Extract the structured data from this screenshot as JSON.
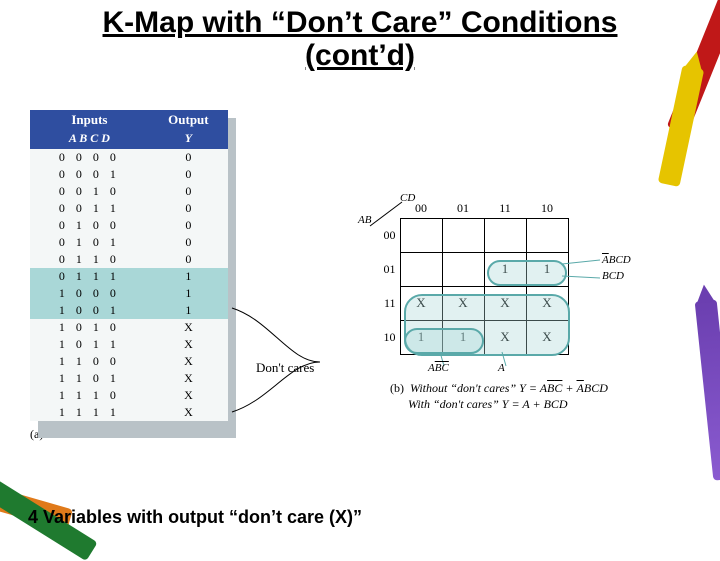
{
  "title_line1": "K-Map with “Don’t Care” Conditions",
  "title_line2": "(cont’d)",
  "truth_table": {
    "head_inputs": "Inputs",
    "head_output": "Output",
    "sub_inputs": "A B C D",
    "sub_output": "Y",
    "rows": [
      {
        "in": "0 0 0 0",
        "out": "0",
        "hi": false
      },
      {
        "in": "0 0 0 1",
        "out": "0",
        "hi": false
      },
      {
        "in": "0 0 1 0",
        "out": "0",
        "hi": false
      },
      {
        "in": "0 0 1 1",
        "out": "0",
        "hi": false
      },
      {
        "in": "0 1 0 0",
        "out": "0",
        "hi": false
      },
      {
        "in": "0 1 0 1",
        "out": "0",
        "hi": false
      },
      {
        "in": "0 1 1 0",
        "out": "0",
        "hi": false
      },
      {
        "in": "0 1 1 1",
        "out": "1",
        "hi": true
      },
      {
        "in": "1 0 0 0",
        "out": "1",
        "hi": true
      },
      {
        "in": "1 0 0 1",
        "out": "1",
        "hi": true
      },
      {
        "in": "1 0 1 0",
        "out": "X",
        "hi": false
      },
      {
        "in": "1 0 1 1",
        "out": "X",
        "hi": false
      },
      {
        "in": "1 1 0 0",
        "out": "X",
        "hi": false
      },
      {
        "in": "1 1 0 1",
        "out": "X",
        "hi": false
      },
      {
        "in": "1 1 1 0",
        "out": "X",
        "hi": false
      },
      {
        "in": "1 1 1 1",
        "out": "X",
        "hi": false
      }
    ],
    "caption": "(a)  Truth table"
  },
  "dont_cares_label": "Don't cares",
  "kmap": {
    "ab": "AB",
    "cd": "CD",
    "cols": [
      "00",
      "01",
      "11",
      "10"
    ],
    "rows": [
      "00",
      "01",
      "11",
      "10"
    ],
    "cells": [
      [
        "",
        "",
        "",
        ""
      ],
      [
        "",
        "",
        "1",
        "1"
      ],
      [
        "X",
        "X",
        "X",
        "X"
      ],
      [
        "1",
        "1",
        "X",
        "X"
      ]
    ],
    "group_labels": {
      "abcd_bar": "ABCD",
      "bcd": "BCD",
      "abc_bar": "ABC",
      "a": "A"
    },
    "caption_prefix": "(b)",
    "caption_without": "Without “don't cares” Y = AB̅C̅ + A̅BCD",
    "caption_with": "With “don't cares” Y = A + BCD"
  },
  "footer": "4 Variables with output “don’t care (X)”"
}
